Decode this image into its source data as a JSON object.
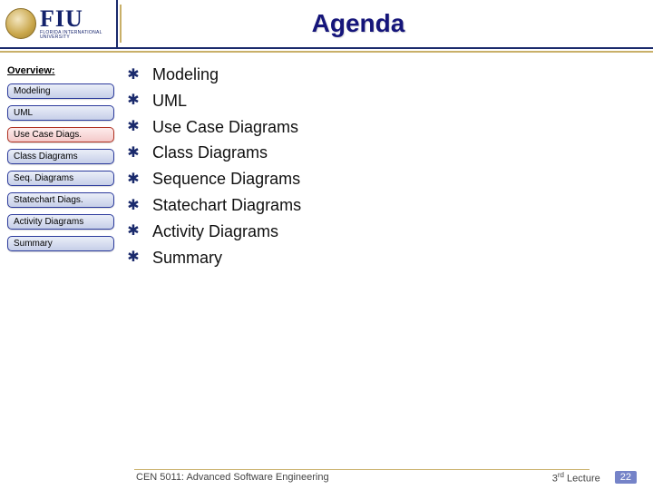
{
  "header": {
    "fiu": "FIU",
    "fiu_sub": "FLORIDA INTERNATIONAL UNIVERSITY",
    "title": "Agenda"
  },
  "sidebar": {
    "heading": "Overview:",
    "items": [
      {
        "label": "Modeling"
      },
      {
        "label": "UML"
      },
      {
        "label": "Use Case Diags."
      },
      {
        "label": "Class Diagrams"
      },
      {
        "label": "Seq. Diagrams"
      },
      {
        "label": "Statechart Diags."
      },
      {
        "label": "Activity Diagrams"
      },
      {
        "label": "Summary"
      }
    ]
  },
  "content": {
    "items": [
      "Modeling",
      "UML",
      "Use Case Diagrams",
      "Class Diagrams",
      "Sequence Diagrams",
      "Statechart Diagrams",
      "Activity Diagrams",
      "Summary"
    ]
  },
  "footer": {
    "course": "CEN 5011: Advanced Software Engineering",
    "lecture_pre": "3",
    "lecture_sup": "rd",
    "lecture_post": " Lecture",
    "slide": "22"
  }
}
